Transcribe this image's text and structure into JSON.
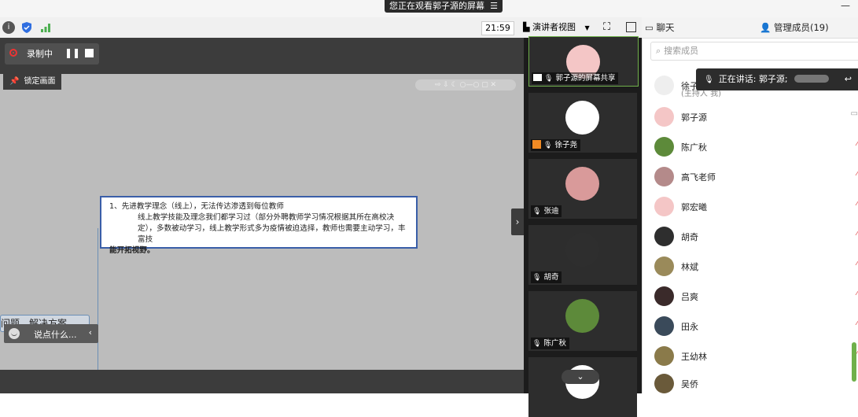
{
  "banner": {
    "text": "您正在观看郭子源的屏幕",
    "menu_glyph": "☰"
  },
  "window": {
    "minimize_glyph": "—"
  },
  "toolbar": {
    "clock": "21:59",
    "view_mode": "演讲者视图"
  },
  "recording": {
    "label": "录制中"
  },
  "stage": {
    "lock_label": "锁定画面",
    "node_line1": "1、先进教学理念（线上），无法传达渗透到每位教师",
    "node_line2": "线上教学技能及理念我们都学习过（部分外聘教师学习情况根据其所在高校决定），多数被动学习，线上教学形式多为疫情被迫选择，教师也需要主动学习，丰富技",
    "node_line3": "能开拓视野。",
    "partial_node": "问题、解决方案",
    "chat_placeholder": "说点什么..."
  },
  "video_tiles": [
    {
      "label": "郭子源的屏幕共享",
      "color": "#f4c6c6"
    },
    {
      "label": "徐子尧",
      "color": "#ffffff"
    },
    {
      "label": "张迪",
      "color": "#d99a9a"
    },
    {
      "label": "胡奇",
      "color": "#2e2e2e"
    },
    {
      "label": "陈广秋",
      "color": "#5d8a3a"
    },
    {
      "label": "",
      "color": "#ffffff"
    }
  ],
  "panel": {
    "tab_chat": "聊天",
    "tab_members": "管理成员(19)",
    "search_placeholder": "搜索成员",
    "speaking_label": "正在讲话: 郭子源;",
    "host_sub": "(主持人 我)",
    "members": [
      {
        "name": "徐子尧",
        "color": "#eeeeee"
      },
      {
        "name": "郭子源",
        "color": "#f4c6c6"
      },
      {
        "name": "陈广秋",
        "color": "#5d8a3a"
      },
      {
        "name": "高飞老师",
        "color": "#b48a8a"
      },
      {
        "name": "郭宏曦",
        "color": "#f4c6c6"
      },
      {
        "name": "胡奇",
        "color": "#2e2e2e"
      },
      {
        "name": "林斌",
        "color": "#9a8a5a"
      },
      {
        "name": "吕爽",
        "color": "#3a2a2a"
      },
      {
        "name": "田永",
        "color": "#3a4a5a"
      },
      {
        "name": "王幼林",
        "color": "#8a7a4a"
      },
      {
        "name": "吴侨",
        "color": "#6a5a3a"
      }
    ]
  },
  "colors": {
    "accent": "#3a5ea8",
    "speaking_green": "#6fb04a",
    "record_red": "#e33333"
  }
}
